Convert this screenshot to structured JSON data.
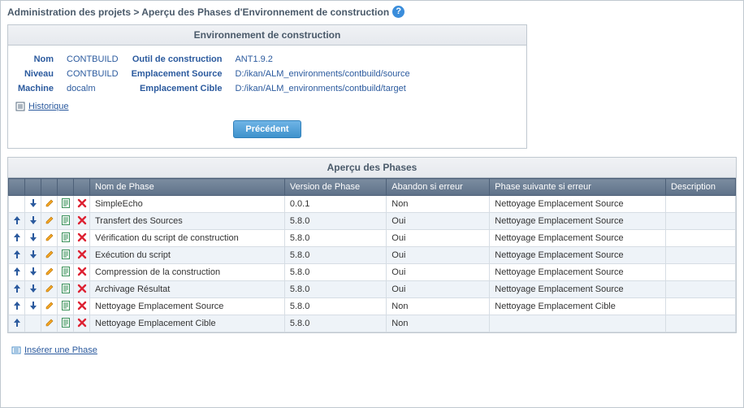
{
  "breadcrumb": "Administration des projets > Aperçu des Phases d'Environnement de construction",
  "env": {
    "title": "Environnement de construction",
    "labels": {
      "nom": "Nom",
      "outil": "Outil de construction",
      "niveau": "Niveau",
      "source": "Emplacement Source",
      "machine": "Machine",
      "cible": "Emplacement Cible"
    },
    "values": {
      "nom": "CONTBUILD",
      "outil": "ANT1.9.2",
      "niveau": "CONTBUILD",
      "source": "D:/ikan/ALM_environments/contbuild/source",
      "machine": "docalm",
      "cible": "D:/ikan/ALM_environments/contbuild/target"
    },
    "history": "Historique",
    "back_button": "Précédent"
  },
  "phases": {
    "title": "Aperçu des Phases",
    "columns": {
      "name": "Nom de Phase",
      "version": "Version de Phase",
      "abort": "Abandon si erreur",
      "next": "Phase suivante si erreur",
      "desc": "Description"
    },
    "rows": [
      {
        "up": false,
        "down": true,
        "name": "SimpleEcho",
        "version": "0.0.1",
        "abort": "Non",
        "next": "Nettoyage Emplacement Source",
        "desc": ""
      },
      {
        "up": true,
        "down": true,
        "name": "Transfert des Sources",
        "version": "5.8.0",
        "abort": "Oui",
        "next": "Nettoyage Emplacement Source",
        "desc": ""
      },
      {
        "up": true,
        "down": true,
        "name": "Vérification du script de construction",
        "version": "5.8.0",
        "abort": "Oui",
        "next": "Nettoyage Emplacement Source",
        "desc": ""
      },
      {
        "up": true,
        "down": true,
        "name": "Exécution du script",
        "version": "5.8.0",
        "abort": "Oui",
        "next": "Nettoyage Emplacement Source",
        "desc": ""
      },
      {
        "up": true,
        "down": true,
        "name": "Compression de la construction",
        "version": "5.8.0",
        "abort": "Oui",
        "next": "Nettoyage Emplacement Source",
        "desc": ""
      },
      {
        "up": true,
        "down": true,
        "name": "Archivage Résultat",
        "version": "5.8.0",
        "abort": "Oui",
        "next": "Nettoyage Emplacement Source",
        "desc": ""
      },
      {
        "up": true,
        "down": true,
        "name": "Nettoyage Emplacement Source",
        "version": "5.8.0",
        "abort": "Non",
        "next": "Nettoyage Emplacement Cible",
        "desc": ""
      },
      {
        "up": true,
        "down": false,
        "name": "Nettoyage Emplacement Cible",
        "version": "5.8.0",
        "abort": "Non",
        "next": "",
        "desc": ""
      }
    ],
    "insert_link": "Insérer une Phase"
  },
  "icons": {
    "up": "arrow-up-icon",
    "down": "arrow-down-icon",
    "edit": "edit-icon",
    "view": "view-params-icon",
    "delete": "delete-icon"
  }
}
